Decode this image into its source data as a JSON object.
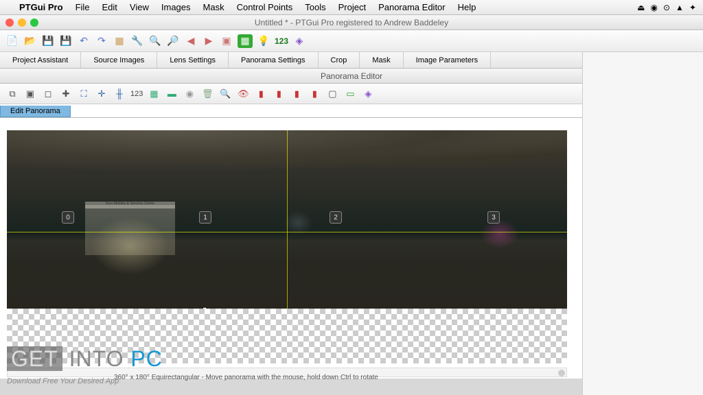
{
  "menubar": {
    "app": "PTGui Pro",
    "items": [
      "File",
      "Edit",
      "View",
      "Images",
      "Mask",
      "Control Points",
      "Tools",
      "Project",
      "Panorama Editor",
      "Help"
    ]
  },
  "window": {
    "title": "Untitled * - PTGui Pro registered to Andrew Baddeley"
  },
  "toolbar_main": {
    "number": "123"
  },
  "tabs": [
    "Project Assistant",
    "Source Images",
    "Lens Settings",
    "Panorama Settings",
    "Crop",
    "Mask",
    "Image Parameters"
  ],
  "subwindow": {
    "title": "Panorama Editor"
  },
  "toolbar_sub": {
    "number": "123"
  },
  "edit_tab": {
    "label": "Edit Panorama"
  },
  "markers": [
    "0",
    "1",
    "2",
    "3"
  ],
  "sign_text": "Euro Mobiles & Services Centre",
  "status": "360° x 180° Equirectangular - Move panorama with the mouse, hold down Ctrl to rotate",
  "watermark": {
    "get": "GET",
    "into": "INTO",
    "pc": "PC"
  },
  "download_text": "Download Free Your Desired App"
}
